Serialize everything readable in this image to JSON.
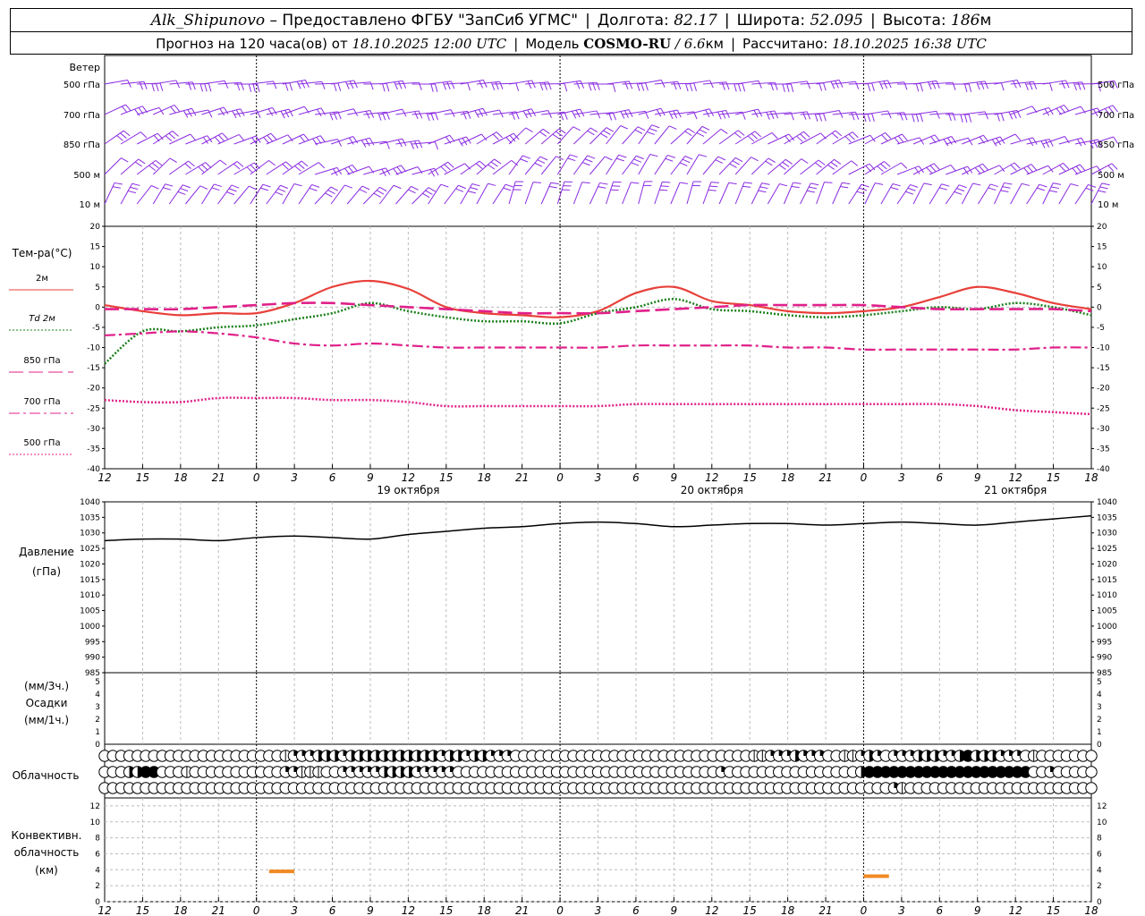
{
  "header": {
    "station": "Alk_Shipunovo",
    "provider": "– Предоставлено ФГБУ \"ЗапСиб УГМС\"",
    "lon_label": "Долгота:",
    "lon_value": "82.17",
    "lat_label": "Широта:",
    "lat_value": "52.095",
    "alt_label": "Высота:",
    "alt_value": "186",
    "alt_unit": "м",
    "forecast_text": "Прогноз на 120 часа(ов) от",
    "forecast_start": "18.10.2025 12:00 UTC",
    "model_label": "Модель",
    "model_name": "COSMO-RU",
    "model_res": "/ 6.6",
    "model_res_unit": "км",
    "calc_label": "Рассчитано:",
    "calc_time": "18.10.2025 16:38 UTC"
  },
  "panels": {
    "wind": {
      "title": "Ветер",
      "levels": [
        "500 гПа",
        "700 гПа",
        "850 гПа",
        "500 м",
        "10 м"
      ],
      "color": "#8a2be2"
    },
    "temp": {
      "title": "Тем-ра(°C)",
      "yticks": [
        20,
        15,
        10,
        5,
        0,
        -5,
        -10,
        -15,
        -20,
        -25,
        -30,
        -35,
        -40
      ]
    },
    "pressure": {
      "title1": "Давление",
      "title2": "(гПа)",
      "yticks": [
        1040,
        1035,
        1030,
        1025,
        1020,
        1015,
        1010,
        1005,
        1000,
        995,
        990,
        985
      ]
    },
    "precip": {
      "title1": "(мм/3ч.)",
      "title2": "Осадки",
      "title3": "(мм/1ч.)",
      "yticks": [
        5,
        4,
        3,
        2,
        1,
        0
      ]
    },
    "cloud": {
      "title": "Облачность"
    },
    "conv": {
      "title1": "Конвективн.",
      "title2": "облачность",
      "title3": "(км)",
      "yticks": [
        12,
        10,
        8,
        6,
        4,
        2,
        0
      ]
    }
  },
  "time_axis": {
    "tick_labels": [
      "12",
      "15",
      "18",
      "21",
      "0",
      "3",
      "6",
      "9",
      "12",
      "15",
      "18",
      "21",
      "0",
      "3",
      "6",
      "9",
      "12",
      "15",
      "18",
      "21",
      "0",
      "3",
      "6",
      "9",
      "12",
      "15",
      "18"
    ],
    "day_labels": [
      "19 октября",
      "20 октября",
      "21 октября"
    ]
  },
  "chart_data": {
    "type": "line",
    "x_hours": [
      0,
      3,
      6,
      9,
      12,
      15,
      18,
      21,
      24,
      27,
      30,
      33,
      36,
      39,
      42,
      45,
      48,
      51,
      54,
      57,
      60,
      63,
      66,
      69,
      72,
      75,
      78
    ],
    "temperature": {
      "ylim": [
        -40,
        20
      ],
      "series": [
        {
          "name": "2м",
          "color": "#e8403a",
          "style": "solid",
          "values": [
            0.5,
            -1.0,
            -2.0,
            -1.5,
            -1.5,
            1.0,
            5.0,
            6.5,
            4.5,
            0.0,
            -1.5,
            -2.0,
            -2.5,
            -1.0,
            3.5,
            5.0,
            1.5,
            0.5,
            -1.0,
            -1.5,
            -1.0,
            0.0,
            2.5,
            5.0,
            3.5,
            1.0,
            -0.5
          ]
        },
        {
          "name": "Td 2м",
          "color": "#1a7f1a",
          "style": "dotted",
          "values": [
            -14,
            -6,
            -6,
            -5,
            -4.5,
            -3.0,
            -1.5,
            1.0,
            -1.0,
            -2.5,
            -3.5,
            -3.5,
            -4.0,
            -1.5,
            0.0,
            2.0,
            -0.5,
            -1.0,
            -2.0,
            -2.5,
            -2.0,
            -1.0,
            0.0,
            -0.5,
            1.0,
            0.0,
            -2.0
          ]
        },
        {
          "name": "850 гПа",
          "color": "#e0208a",
          "style": "longdash",
          "values": [
            -0.5,
            -0.5,
            -0.5,
            0.0,
            0.5,
            1.0,
            1.0,
            0.5,
            0.0,
            -0.5,
            -1.0,
            -1.5,
            -1.5,
            -1.5,
            -1.0,
            -0.5,
            0.0,
            0.5,
            0.5,
            0.5,
            0.5,
            0.0,
            -0.5,
            -0.5,
            -0.5,
            -0.5,
            -1.0
          ]
        },
        {
          "name": "700 гПа",
          "color": "#e0208a",
          "style": "dashdot",
          "values": [
            -7,
            -6.5,
            -6,
            -6.5,
            -7.5,
            -9,
            -9.5,
            -9,
            -9.5,
            -10,
            -10,
            -10,
            -10,
            -10,
            -9.5,
            -9.5,
            -9.5,
            -9.5,
            -10,
            -10,
            -10.5,
            -10.5,
            -10.5,
            -10.5,
            -10.5,
            -10,
            -10
          ]
        },
        {
          "name": "500 гПа",
          "color": "#e0208a",
          "style": "dotted",
          "values": [
            -23,
            -23.5,
            -23.5,
            -22.5,
            -22.5,
            -22.5,
            -23,
            -23,
            -23.5,
            -24.5,
            -24.5,
            -24.5,
            -24.5,
            -24.5,
            -24,
            -24,
            -24,
            -24,
            -24,
            -24,
            -24,
            -24,
            -24,
            -24.5,
            -25.5,
            -26,
            -26.5
          ]
        }
      ]
    },
    "pressure": {
      "ylim": [
        985,
        1040
      ],
      "series": [
        {
          "name": "Давление",
          "color": "#000000",
          "values": [
            1027.5,
            1028,
            1028,
            1027.5,
            1028.5,
            1029,
            1028.5,
            1028,
            1029.5,
            1030.5,
            1031.5,
            1032,
            1033,
            1033.5,
            1033,
            1032,
            1032.5,
            1033,
            1033,
            1032.5,
            1033,
            1033.5,
            1033,
            1032.5,
            1033.5,
            1034.5,
            1035.5
          ]
        }
      ]
    },
    "precipitation": {
      "ylim": [
        0,
        5
      ],
      "values": []
    },
    "cloud_rows": {
      "upper": [
        0,
        0,
        0,
        0,
        0,
        0,
        0,
        0,
        0,
        0,
        0,
        0,
        0,
        0,
        0,
        0,
        0,
        0,
        0,
        0,
        0,
        0,
        1,
        2,
        2,
        2,
        3,
        3,
        3,
        2,
        3,
        3,
        3,
        3,
        3,
        3,
        3,
        3,
        3,
        3,
        3,
        2,
        3,
        3,
        2,
        3,
        3,
        2,
        2,
        2,
        0,
        0,
        0,
        0,
        0,
        0,
        0,
        0,
        0,
        0,
        0,
        0,
        0,
        0,
        0,
        0,
        0,
        0,
        0,
        0,
        0,
        0,
        0,
        0,
        0,
        0,
        0,
        0,
        0,
        1,
        1,
        2,
        2,
        2,
        3,
        2,
        2,
        2,
        0,
        0,
        1,
        1,
        2,
        3,
        2,
        0,
        2,
        2,
        2,
        3,
        3,
        3,
        2,
        2,
        3,
        4,
        3,
        3,
        3,
        2,
        2,
        2,
        0,
        1,
        0,
        0,
        0,
        0,
        0,
        0,
        0
      ],
      "middle": [
        0,
        0,
        0,
        3,
        3,
        4,
        4,
        0,
        0,
        0,
        1,
        0,
        0,
        0,
        0,
        0,
        0,
        0,
        0,
        0,
        0,
        0,
        2,
        2,
        1,
        1,
        1,
        0,
        0,
        2,
        2,
        2,
        2,
        2,
        3,
        3,
        3,
        3,
        2,
        2,
        2,
        2,
        2,
        0,
        0,
        0,
        0,
        0,
        0,
        0,
        0,
        0,
        0,
        0,
        0,
        0,
        0,
        0,
        0,
        0,
        0,
        0,
        0,
        0,
        0,
        0,
        0,
        0,
        0,
        0,
        0,
        0,
        0,
        0,
        0,
        2,
        0,
        0,
        0,
        0,
        0,
        0,
        0,
        0,
        0,
        0,
        0,
        0,
        0,
        0,
        0,
        0,
        3,
        4,
        4,
        4,
        4,
        4,
        4,
        4,
        4,
        4,
        4,
        4,
        4,
        4,
        4,
        4,
        4,
        4,
        4,
        4,
        4,
        0,
        0,
        2,
        0,
        0,
        0,
        0,
        0
      ],
      "lower": [
        0,
        0,
        0,
        0,
        0,
        0,
        0,
        0,
        0,
        0,
        0,
        0,
        0,
        0,
        0,
        0,
        0,
        0,
        0,
        0,
        0,
        0,
        0,
        0,
        0,
        0,
        0,
        0,
        0,
        0,
        0,
        0,
        0,
        0,
        0,
        0,
        0,
        0,
        0,
        0,
        0,
        0,
        0,
        0,
        0,
        0,
        0,
        0,
        0,
        0,
        0,
        0,
        0,
        0,
        0,
        0,
        0,
        0,
        0,
        0,
        0,
        0,
        0,
        0,
        0,
        0,
        0,
        0,
        0,
        0,
        0,
        0,
        0,
        0,
        0,
        0,
        0,
        0,
        0,
        0,
        0,
        0,
        0,
        0,
        0,
        0,
        0,
        0,
        0,
        0,
        0,
        0,
        0,
        0,
        0,
        0,
        2,
        1,
        0,
        0,
        0,
        0,
        0,
        0,
        0,
        0,
        0,
        0,
        0,
        0,
        0,
        0,
        0,
        0,
        0,
        0,
        0,
        0,
        0,
        0,
        0
      ]
    },
    "convective_cloud": {
      "ylim": [
        0,
        13
      ],
      "color": "#f08a24",
      "segments": [
        {
          "from_hour": 13.0,
          "to_hour": 15.0,
          "height_km": 3.8
        },
        {
          "from_hour": 60.0,
          "to_hour": 62.0,
          "height_km": 3.2
        }
      ]
    },
    "wind_barbs": {
      "levels": [
        "500 гПа",
        "700 гПа",
        "850 гПа",
        "500 м",
        "10 м"
      ],
      "direction_deg": [
        [
          265,
          265,
          265,
          265,
          265,
          265,
          265,
          265,
          265,
          265,
          265,
          265,
          265,
          265,
          265,
          265,
          265,
          265,
          265,
          265,
          265,
          265,
          265,
          265,
          265,
          265,
          265
        ],
        [
          250,
          250,
          255,
          255,
          255,
          255,
          260,
          260,
          260,
          260,
          260,
          260,
          260,
          260,
          260,
          260,
          260,
          260,
          265,
          265,
          265,
          265,
          265,
          265,
          250,
          250,
          250
        ],
        [
          240,
          240,
          245,
          245,
          245,
          250,
          255,
          260,
          260,
          250,
          240,
          230,
          225,
          220,
          220,
          225,
          230,
          240,
          240,
          240,
          245,
          250,
          250,
          250,
          255,
          255,
          255
        ],
        [
          230,
          230,
          235,
          235,
          235,
          240,
          250,
          250,
          250,
          240,
          230,
          220,
          215,
          215,
          215,
          215,
          220,
          225,
          230,
          235,
          240,
          245,
          245,
          245,
          245,
          245,
          245
        ],
        [
          210,
          215,
          215,
          215,
          215,
          215,
          220,
          220,
          220,
          215,
          210,
          200,
          200,
          200,
          200,
          200,
          200,
          205,
          205,
          205,
          210,
          210,
          210,
          210,
          210,
          210,
          210
        ]
      ]
    }
  }
}
